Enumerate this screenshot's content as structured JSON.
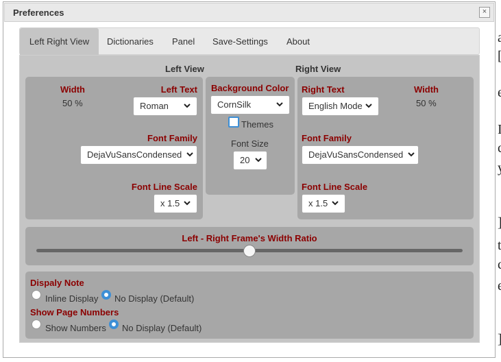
{
  "window": {
    "title": "Preferences",
    "close_glyph": "×"
  },
  "tabs": [
    {
      "label": "Left Right View",
      "active": true
    },
    {
      "label": "Dictionaries"
    },
    {
      "label": "Panel"
    },
    {
      "label": "Save-Settings"
    },
    {
      "label": "About"
    }
  ],
  "left_view": {
    "heading": "Left View",
    "width_label": "Width",
    "width_value": "50 %",
    "text_label": "Left Text",
    "text_value": "Roman",
    "font_family_label": "Font Family",
    "font_family_value": "DejaVuSansCondensed",
    "line_scale_label": "Font Line Scale",
    "line_scale_value": "x 1.5"
  },
  "center": {
    "bg_label": "Background Color",
    "bg_value": "CornSilk",
    "themes_label": "Themes",
    "themes_checked": false,
    "font_size_label": "Font Size",
    "font_size_value": "20"
  },
  "right_view": {
    "heading": "Right View",
    "text_label": "Right Text",
    "text_value": "English Mode",
    "width_label": "Width",
    "width_value": "50 %",
    "font_family_label": "Font Family",
    "font_family_value": "DejaVuSansCondensed",
    "line_scale_label": "Font Line Scale",
    "line_scale_value": "x 1.5"
  },
  "ratio": {
    "label": "Left - Right Frame's Width Ratio",
    "value": 0.5
  },
  "display_note": {
    "label": "Dispaly Note",
    "options": [
      "Inline Display",
      "No Display (Default)"
    ],
    "selected": 1
  },
  "page_numbers": {
    "label": "Show Page Numbers",
    "options": [
      "Show Numbers",
      "No Display (Default)"
    ],
    "selected": 1
  },
  "edge_glyphs": [
    "a",
    "[",
    "e",
    "I",
    "c",
    "y",
    "]",
    "t",
    "c",
    "e",
    "]"
  ],
  "colors": {
    "label": "#8b0000",
    "panel": "#c5c5c5",
    "box": "#a7a7a7",
    "accent": "#3d8fd6"
  }
}
